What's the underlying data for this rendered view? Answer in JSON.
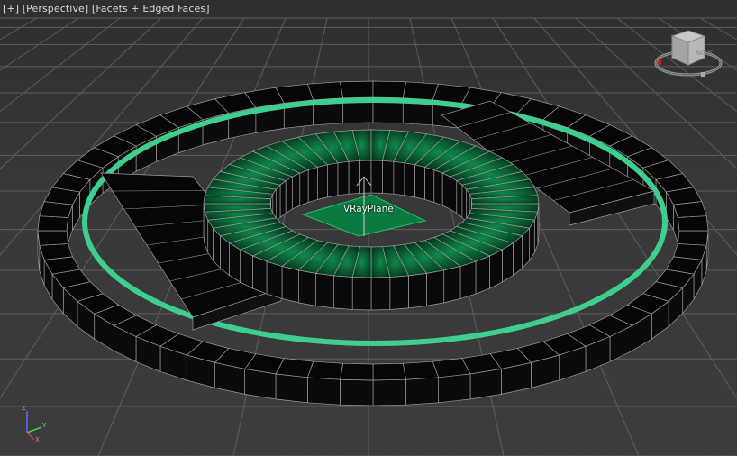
{
  "viewport": {
    "menu_plus": "[+]",
    "view_name": "[Perspective]",
    "shading_mode": "[Facets + Edged Faces]"
  },
  "scene": {
    "object_label": "VRayPlane"
  },
  "viewcube": {
    "face_label": "RIGHT"
  },
  "axis_tripod": {
    "x_label": "X",
    "y_label": "Y",
    "z_label": "Z"
  },
  "colors": {
    "background": "#3a3a3a",
    "grid": "#6e6e6e",
    "mesh_black": "#060606",
    "wireframe": "#9a9a9a",
    "accent_ring": "#3ecf8e",
    "selected_green": "#0c6e3c",
    "label_text": "#d6d6d6"
  }
}
